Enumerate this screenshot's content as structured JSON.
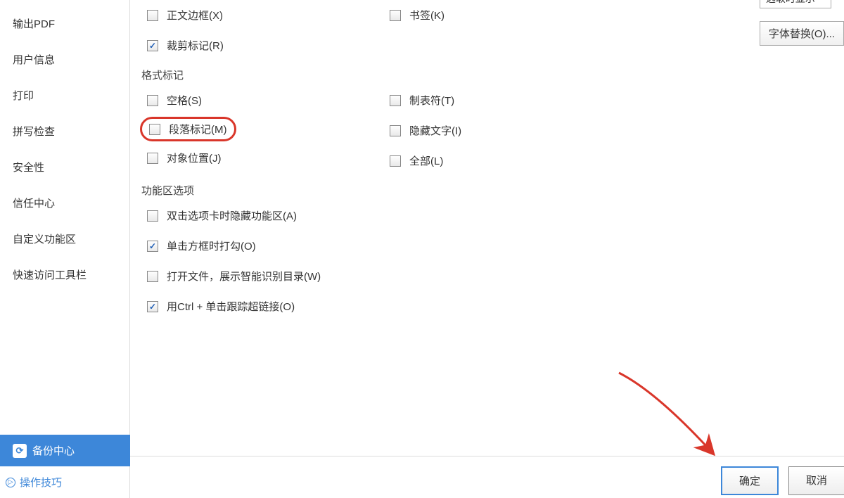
{
  "sidebar": {
    "items": [
      "输出PDF",
      "用户信息",
      "打印",
      "拼写检查",
      "安全性",
      "信任中心",
      "自定义功能区",
      "快速访问工具栏"
    ],
    "backup_center": "备份中心",
    "tips": "操作技巧"
  },
  "top": {
    "dropdown": "选取时显示",
    "font_sub": "字体替换(O)..."
  },
  "group_top": {
    "left": [
      {
        "label": "正文边框(X)",
        "checked": false
      },
      {
        "label": "裁剪标记(R)",
        "checked": true
      }
    ],
    "right": [
      {
        "label": "书签(K)",
        "checked": false
      }
    ]
  },
  "format_marks": {
    "title": "格式标记",
    "left": [
      {
        "label": "空格(S)",
        "checked": false
      },
      {
        "label": "段落标记(M)",
        "checked": false,
        "highlighted": true
      },
      {
        "label": "对象位置(J)",
        "checked": false
      }
    ],
    "right": [
      {
        "label": "制表符(T)",
        "checked": false
      },
      {
        "label": "隐藏文字(I)",
        "checked": false
      },
      {
        "label": "全部(L)",
        "checked": false
      }
    ]
  },
  "ribbon": {
    "title": "功能区选项",
    "items": [
      {
        "label": "双击选项卡时隐藏功能区(A)",
        "checked": false
      },
      {
        "label": "单击方框时打勾(O)",
        "checked": true
      },
      {
        "label": "打开文件，展示智能识别目录(W)",
        "checked": false
      },
      {
        "label": "用Ctrl + 单击跟踪超链接(O)",
        "checked": true
      }
    ]
  },
  "buttons": {
    "ok": "确定",
    "cancel": "取消"
  }
}
